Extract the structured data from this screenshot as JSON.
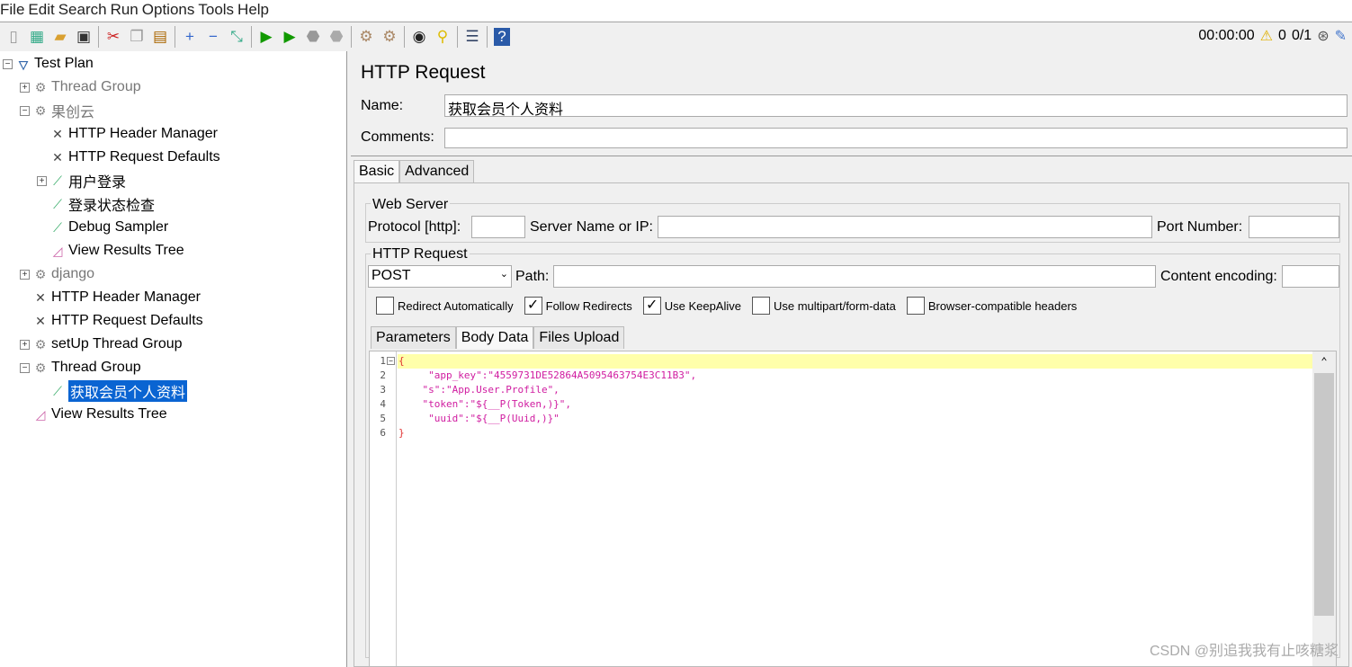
{
  "menu": [
    "File",
    "Edit",
    "Search",
    "Run",
    "Options",
    "Tools",
    "Help"
  ],
  "toolbar_icons": [
    "new-icon",
    "templates-icon",
    "open-icon",
    "save-icon",
    "cut-icon",
    "copy-icon",
    "paste-icon",
    "expand-icon",
    "collapse-icon",
    "toggle-icon",
    "start-icon",
    "start-no-pauses-icon",
    "stop-icon",
    "shutdown-icon",
    "clear-icon",
    "clear-all-icon",
    "search-icon",
    "reset-search-icon",
    "function-helper-icon",
    "help-icon"
  ],
  "status": {
    "time": "00:00:00",
    "warnings": "0",
    "threads": "0/1"
  },
  "tree": [
    {
      "label": "Test Plan",
      "level": 0,
      "exp": "−",
      "icon": "flask",
      "style": ""
    },
    {
      "label": "Thread Group",
      "level": 1,
      "exp": "+",
      "icon": "gear",
      "style": "gray"
    },
    {
      "label": "果创云",
      "level": 1,
      "exp": "−",
      "icon": "gear",
      "style": "gray"
    },
    {
      "label": "HTTP Header Manager",
      "level": 2,
      "exp": "",
      "icon": "tools",
      "style": ""
    },
    {
      "label": "HTTP Request Defaults",
      "level": 2,
      "exp": "",
      "icon": "tools",
      "style": ""
    },
    {
      "label": "用户登录",
      "level": 2,
      "exp": "+",
      "icon": "pipette",
      "style": ""
    },
    {
      "label": "登录状态检查",
      "level": 2,
      "exp": "",
      "icon": "pipette",
      "style": ""
    },
    {
      "label": "Debug Sampler",
      "level": 2,
      "exp": "",
      "icon": "pipette",
      "style": ""
    },
    {
      "label": "View Results Tree",
      "level": 2,
      "exp": "",
      "icon": "chart",
      "style": ""
    },
    {
      "label": "django",
      "level": 1,
      "exp": "+",
      "icon": "gear",
      "style": "gray"
    },
    {
      "label": "HTTP Header Manager",
      "level": 1,
      "exp": "",
      "icon": "tools",
      "style": ""
    },
    {
      "label": "HTTP Request Defaults",
      "level": 1,
      "exp": "",
      "icon": "tools",
      "style": ""
    },
    {
      "label": "setUp Thread Group",
      "level": 1,
      "exp": "+",
      "icon": "gear",
      "style": ""
    },
    {
      "label": "Thread Group",
      "level": 1,
      "exp": "−",
      "icon": "gear",
      "style": ""
    },
    {
      "label": "获取会员个人资料",
      "level": 2,
      "exp": "",
      "icon": "pipette",
      "style": "sel"
    },
    {
      "label": "View Results Tree",
      "level": 1,
      "exp": "",
      "icon": "chart",
      "style": ""
    }
  ],
  "panel": {
    "title": "HTTP Request",
    "name_label": "Name:",
    "name_value": "获取会员个人资料",
    "comments_label": "Comments:",
    "comments_value": "",
    "tabs": [
      "Basic",
      "Advanced"
    ],
    "web_server": "Web Server",
    "protocol_label": "Protocol [http]:",
    "server_label": "Server Name or IP:",
    "port_label": "Port Number:",
    "http_request": "HTTP Request",
    "method": "POST",
    "path_label": "Path:",
    "encoding_label": "Content encoding:",
    "checkboxes": [
      {
        "label": "Redirect Automatically",
        "checked": false
      },
      {
        "label": "Follow Redirects",
        "checked": true
      },
      {
        "label": "Use KeepAlive",
        "checked": true
      },
      {
        "label": "Use multipart/form-data",
        "checked": false
      },
      {
        "label": "Browser-compatible headers",
        "checked": false
      }
    ],
    "subtabs": [
      "Parameters",
      "Body Data",
      "Files Upload"
    ],
    "body_lines": [
      "{",
      "     \"app_key\":\"4559731DE52864A5095463754E3C11B3\",",
      "    \"s\":\"App.User.Profile\",",
      "    \"token\":\"${__P(Token,)}\",",
      "     \"uuid\":\"${__P(Uuid,)}\"",
      "}"
    ]
  },
  "watermark": "CSDN @别追我我有止咳糖浆"
}
